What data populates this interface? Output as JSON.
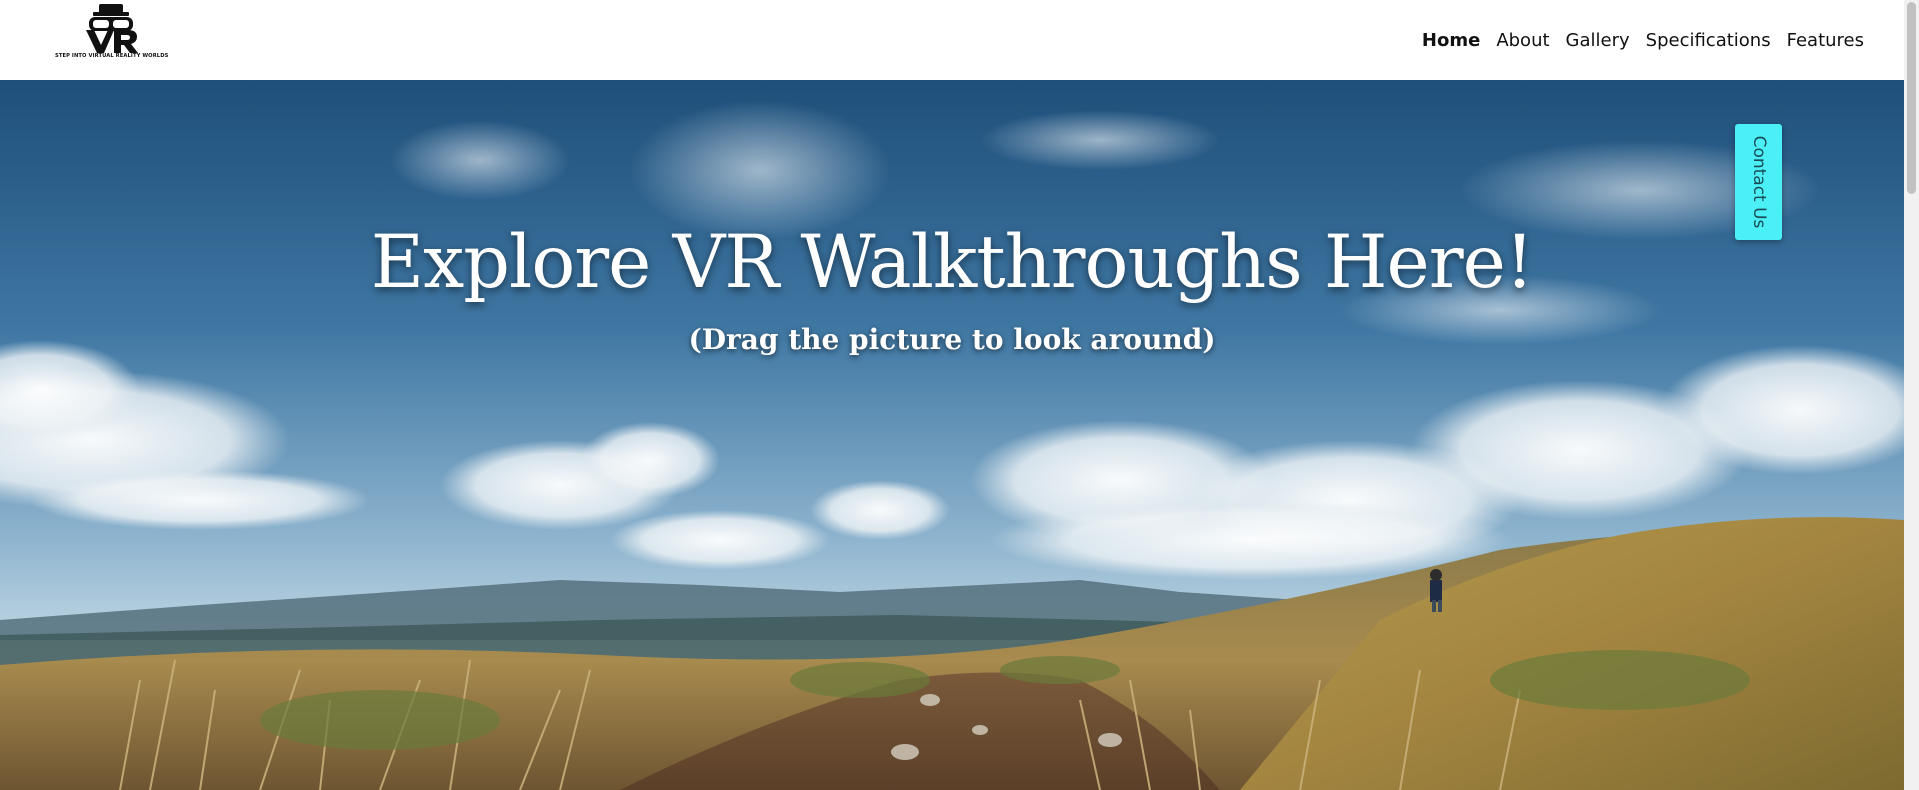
{
  "logo": {
    "mark": "VR",
    "tagline": "STEP INTO VIRTUAL REALITY WORLDS"
  },
  "nav": {
    "items": [
      {
        "label": "Home",
        "active": true
      },
      {
        "label": "About"
      },
      {
        "label": "Gallery"
      },
      {
        "label": "Specifications"
      },
      {
        "label": "Features"
      }
    ]
  },
  "hero": {
    "title": "Explore VR Walkthroughs Here!",
    "subtitle": "(Drag the picture to look around)"
  },
  "contact": {
    "label": "Contact Us"
  },
  "colors": {
    "accent": "#4af0f5",
    "header_bg": "#ffffff",
    "text": "#111111"
  }
}
